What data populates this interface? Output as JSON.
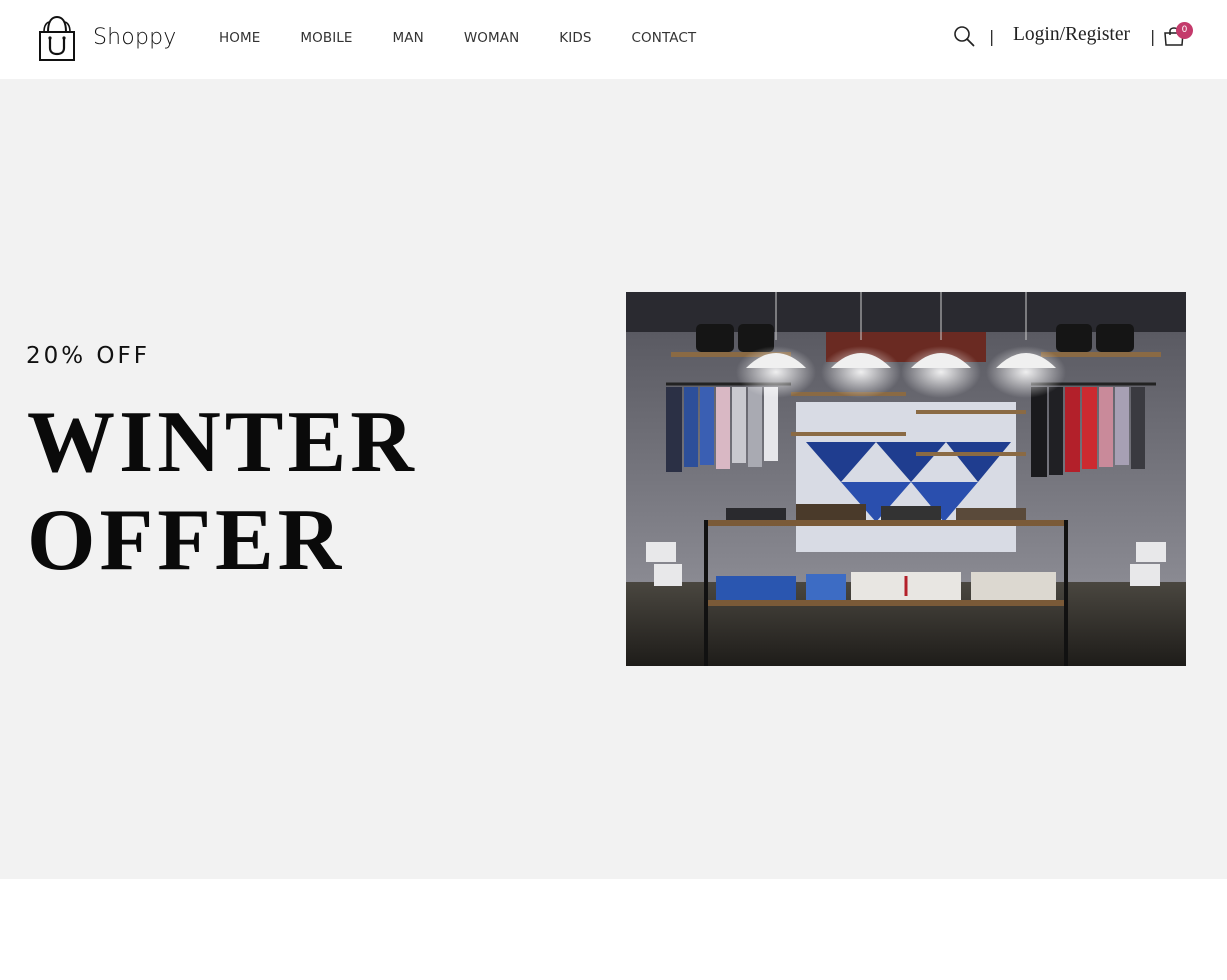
{
  "brand": {
    "name": "Shoppy",
    "logo_icon": "shopping-bag-icon"
  },
  "nav": {
    "items": [
      {
        "label": "HOME"
      },
      {
        "label": "MOBILE"
      },
      {
        "label": "MAN"
      },
      {
        "label": "WOMAN"
      },
      {
        "label": "KIDS"
      },
      {
        "label": "CONTACT"
      }
    ]
  },
  "tools": {
    "search_icon": "search-icon",
    "separator": "|",
    "login_label": "Login/Register",
    "cart_icon": "cart-icon",
    "cart_count": "0"
  },
  "hero": {
    "offer": "20% OFF",
    "title_line1": "WINTER",
    "title_line2": "OFFER",
    "image_subject": "clothing store interior photo"
  },
  "colors": {
    "hero_bg": "#f2f2f2",
    "badge": "#c43a6b",
    "text": "#111111"
  }
}
